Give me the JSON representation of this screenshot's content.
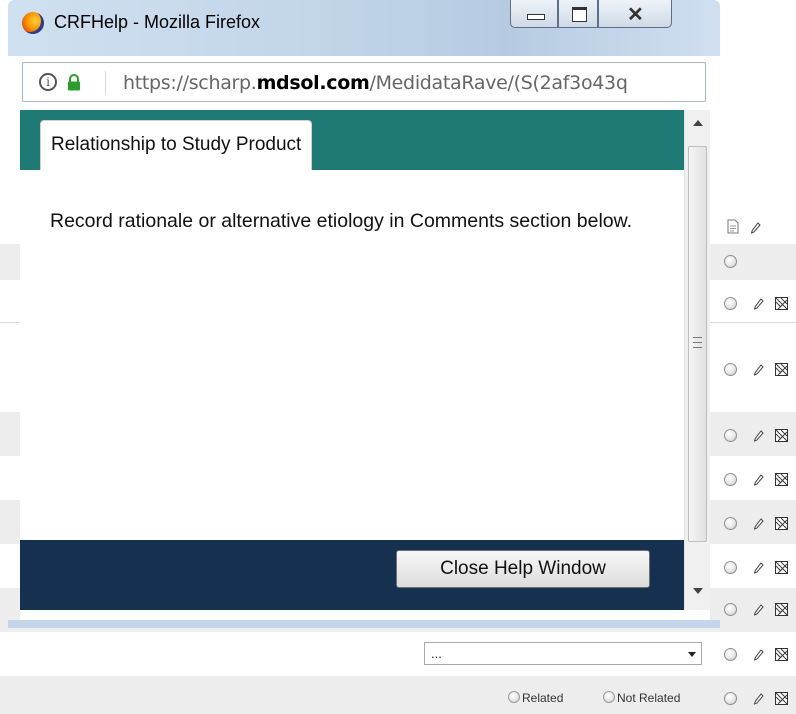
{
  "window": {
    "title": "CRFHelp - Mozilla Firefox",
    "url_prefix": "https://scharp.",
    "url_domain": "mdsol.com",
    "url_suffix": "/MedidataRave/(S(2af3o43q"
  },
  "help": {
    "tab_label": "Relationship to Study Product",
    "body_text": "Record rationale or alternative etiology in Comments section below.",
    "close_button_label": "Close Help Window"
  },
  "background": {
    "select_value": "...",
    "radio_related_label": "Related",
    "radio_not_related_label": "Not Related"
  },
  "icons": {
    "firefox": "firefox-logo",
    "info": "info-icon",
    "lock": "lock-icon",
    "note": "document-icon",
    "pen": "pencil-icon",
    "review": "crossed-box-icon"
  },
  "colors": {
    "tab_bar": "#1f7a75",
    "footer": "#15314f",
    "title_bar": "#c3d6ea"
  }
}
